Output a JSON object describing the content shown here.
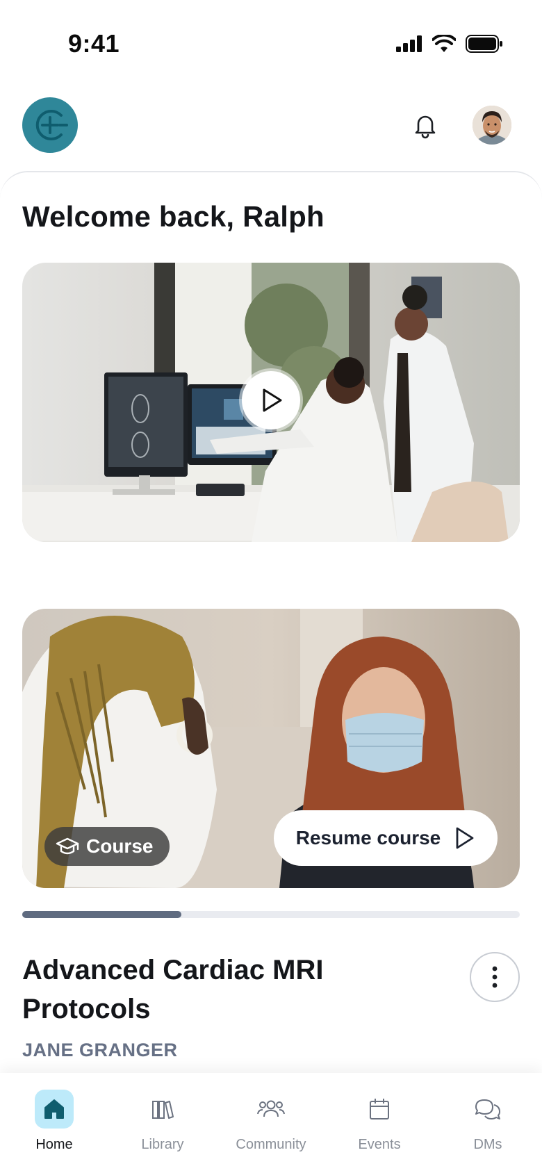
{
  "status_bar": {
    "time": "9:41"
  },
  "header": {
    "logo_icon": "crosshair-logo-icon",
    "notification_icon": "bell-icon",
    "avatar_icon": "user-avatar"
  },
  "home": {
    "welcome": "Welcome back, Ralph",
    "featured_video": {
      "play_icon": "play-icon"
    },
    "course_card": {
      "badge_label": "Course",
      "badge_icon": "graduation-cap-icon",
      "resume_label": "Resume course",
      "progress": 0.32,
      "title": "Advanced Cardiac MRI Protocols",
      "author": "JANE GRANGER",
      "more_icon": "more-vertical-icon"
    }
  },
  "tab_bar": {
    "active": "Home",
    "items": [
      {
        "label": "Home",
        "icon": "home-icon"
      },
      {
        "label": "Library",
        "icon": "books-icon"
      },
      {
        "label": "Community",
        "icon": "people-icon"
      },
      {
        "label": "Events",
        "icon": "calendar-icon"
      },
      {
        "label": "DMs",
        "icon": "chat-bubbles-icon"
      }
    ]
  },
  "colors": {
    "brand": "#2f8799",
    "active_tab_bg": "#bdeafa",
    "progress_fill": "#5f6b80",
    "progress_track": "#e9ebf0"
  }
}
